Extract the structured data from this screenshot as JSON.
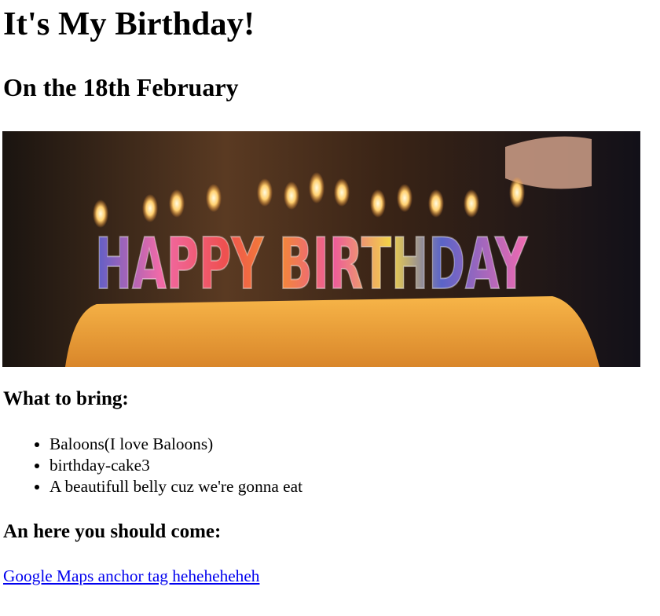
{
  "title": "It's My Birthday!",
  "subtitle": "On the 18th February",
  "image": {
    "candle_text": "HAPPY BIRTHDAY"
  },
  "bring_heading": "What to bring:",
  "bring_items": [
    "Baloons(I love Baloons)",
    "birthday-cake3",
    "A beautifull belly cuz we're gonna eat"
  ],
  "come_heading": "An here you should come:",
  "link_text": "Google Maps anchor tag heheheheheh"
}
